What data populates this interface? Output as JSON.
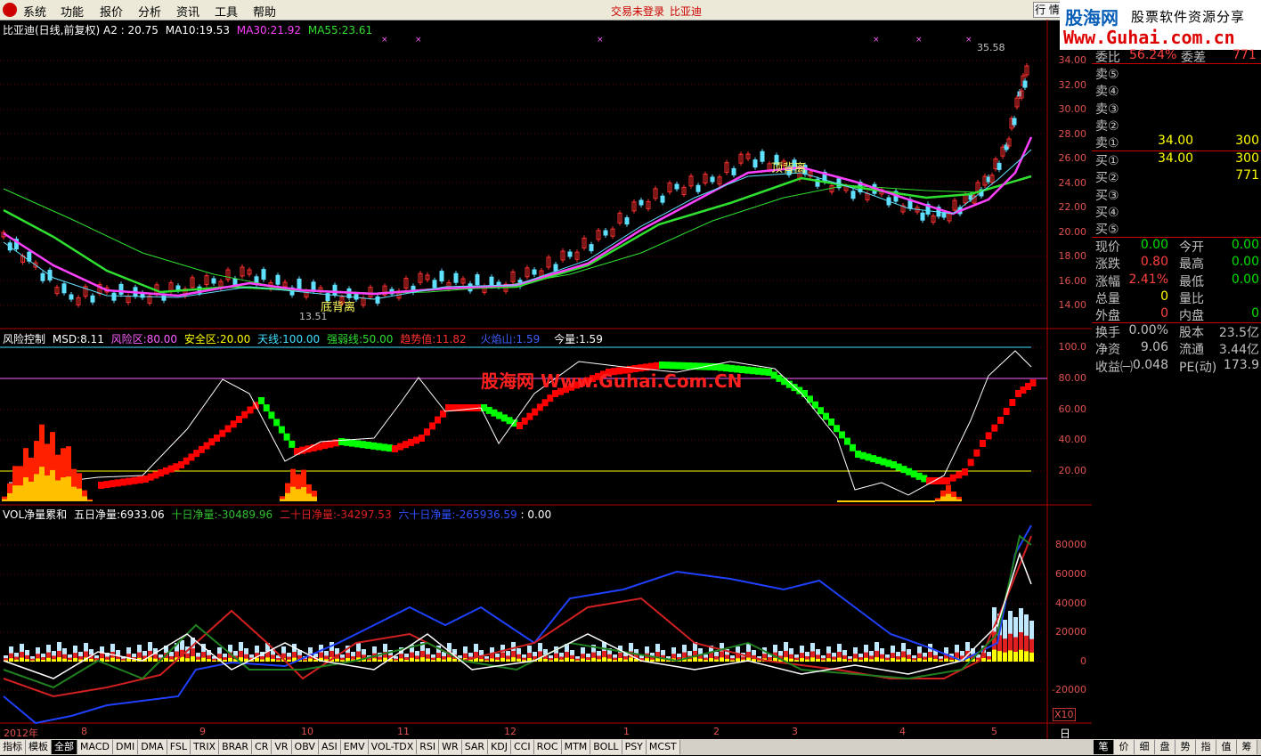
{
  "menu": {
    "items": [
      "系统",
      "功能",
      "报价",
      "分析",
      "资讯",
      "工具",
      "帮助"
    ],
    "status": "交易未登录",
    "stock": "比亚迪",
    "hq_button": "行 情"
  },
  "watermark": {
    "brand": "股海网",
    "tagline": "股票软件资源分享",
    "url": "Www.Guhai.com.cn",
    "center": "股海网 Www.Guhai.Com.CN"
  },
  "price_panel": {
    "title": "比亚迪(日线,前复权)",
    "a2_label": "A2 :",
    "a2": "20.75",
    "ma10_label": "MA10:",
    "ma10": "19.53",
    "ma30_label": "MA30:",
    "ma30": "21.92",
    "ma55_label": "MA55:",
    "ma55": "23.61",
    "high_mark": "35.58",
    "low_mark": "13.51",
    "bottom_div": "底背离",
    "top_div": "顶背离",
    "yticks": [
      "34.00",
      "32.00",
      "30.00",
      "28.00",
      "26.00",
      "24.00",
      "22.00",
      "20.00",
      "18.00",
      "16.00",
      "14.00"
    ]
  },
  "risk_panel": {
    "title": "风险控制",
    "msd_label": "MSD:",
    "msd": "8.11",
    "risk_label": "风险区:",
    "risk": "80.00",
    "safe_label": "安全区:",
    "safe": "20.00",
    "sky_label": "天线:",
    "sky": "100.00",
    "strong_label": "强弱线:",
    "strong": "50.00",
    "trend_label": "趋势值:",
    "trend": "11.82",
    "fire_label": "火焰山:",
    "fire": "1.59",
    "vol_label": "今量:",
    "vol": "1.59",
    "yticks": [
      "100.0",
      "80.00",
      "60.00",
      "40.00",
      "20.00"
    ]
  },
  "vol_panel": {
    "title": "VOL净量累和",
    "d5_label": "五日净量:",
    "d5": "6933.06",
    "d10_label": "十日净量:",
    "d10": "-30489.96",
    "d20_label": "二十日净量:",
    "d20": "-34297.53",
    "d60_label": "六十日净量:",
    "d60": "-265936.59",
    "tail": ": 0.00",
    "yticks": [
      "80000",
      "60000",
      "40000",
      "20000",
      "0",
      "-20000"
    ],
    "x10": "X10"
  },
  "xaxis": {
    "labels": [
      "2012年",
      "8",
      "9",
      "10",
      "11",
      "12",
      "1",
      "2",
      "3",
      "4",
      "5"
    ],
    "period": "日线"
  },
  "quote": {
    "weibi_label": "委比",
    "weibi": "56.24%",
    "weicha_label": "委差",
    "weicha": "771",
    "sells": [
      {
        "label": "卖⑤",
        "price": "",
        "vol": ""
      },
      {
        "label": "卖④",
        "price": "",
        "vol": ""
      },
      {
        "label": "卖③",
        "price": "",
        "vol": ""
      },
      {
        "label": "卖②",
        "price": "",
        "vol": ""
      },
      {
        "label": "卖①",
        "price": "34.00",
        "vol": "300"
      }
    ],
    "buys": [
      {
        "label": "买①",
        "price": "34.00",
        "vol": "300"
      },
      {
        "label": "买②",
        "price": "",
        "vol": "771"
      },
      {
        "label": "买③",
        "price": "",
        "vol": ""
      },
      {
        "label": "买④",
        "price": "",
        "vol": ""
      },
      {
        "label": "买⑤",
        "price": "",
        "vol": ""
      }
    ],
    "stats": [
      {
        "l1": "现价",
        "v1": "0.00",
        "l2": "今开",
        "v2": "0.00"
      },
      {
        "l1": "涨跌",
        "v1": "0.80",
        "l2": "最高",
        "v2": "0.00"
      },
      {
        "l1": "涨幅",
        "v1": "2.41%",
        "l2": "最低",
        "v2": "0.00"
      },
      {
        "l1": "总量",
        "v1": "0",
        "l2": "量比",
        "v2": ""
      },
      {
        "l1": "外盘",
        "v1": "0",
        "l2": "内盘",
        "v2": "0"
      }
    ],
    "fin": [
      {
        "l1": "换手",
        "v1": "0.00%",
        "l2": "股本",
        "v2": "23.5亿"
      },
      {
        "l1": "净资",
        "v1": "9.06",
        "l2": "流通",
        "v2": "3.44亿"
      },
      {
        "l1": "收益㈠",
        "v1": "0.048",
        "l2": "PE(动)",
        "v2": "173.9"
      }
    ]
  },
  "tabs": [
    "指标",
    "模板",
    "全部",
    "MACD",
    "DMI",
    "DMA",
    "FSL",
    "TRIX",
    "BRAR",
    "CR",
    "VR",
    "OBV",
    "ASI",
    "EMV",
    "VOL-TDX",
    "RSI",
    "WR",
    "SAR",
    "KDJ",
    "CCI",
    "ROC",
    "MTM",
    "BOLL",
    "PSY",
    "MCST"
  ],
  "right_tabs": [
    "笔",
    "价",
    "细",
    "盘",
    "势",
    "指",
    "值",
    "筹"
  ],
  "colors": {
    "up": "#ff3030",
    "down": "#60e0ff",
    "ma10": "#ff40ff",
    "ma30": "#30e030",
    "ma55": "#30e030",
    "risk_green": "#00ff00",
    "risk_red": "#ff0000"
  }
}
